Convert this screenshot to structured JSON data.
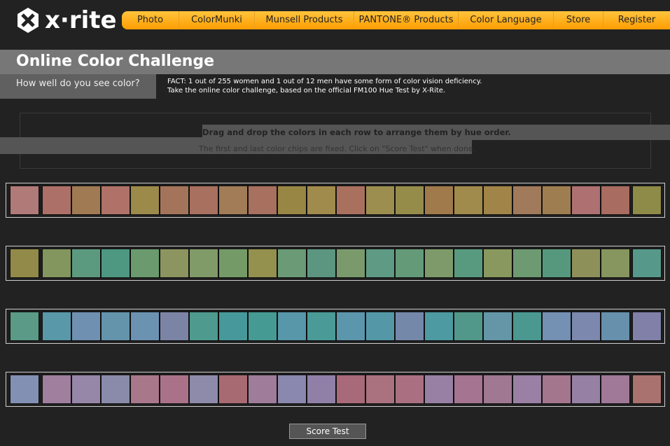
{
  "brand": {
    "logo_text": "x·rite"
  },
  "nav": [
    "Photo",
    "ColorMunki",
    "Munsell Products",
    "PANTONE® Products",
    "Color Language",
    "Store",
    "Register"
  ],
  "page": {
    "title": "Online Color Challenge",
    "subtitle": "How well do you see color?",
    "fact_line1": "FACT: 1 out of 255 women and 1 out of 12 men have some form of color vision deficiency.",
    "fact_line2": "Take the online color challenge, based on the official FM100 Hue Test by X-Rite.",
    "instruction1": "Drag and drop the colors in each row to arrange them by hue order.",
    "instruction2": "The first and last color chips are fixed. Click on \"Score Test\" when done."
  },
  "rows": [
    [
      "#b07a78",
      "#ad7068",
      "#a07a52",
      "#b07268",
      "#9c8a4a",
      "#a4745a",
      "#a8705e",
      "#a27c56",
      "#a8705e",
      "#988644",
      "#a08a4c",
      "#aa705e",
      "#9c8e4e",
      "#968c4a",
      "#a07a4a",
      "#a08a4c",
      "#a08448",
      "#a07a5a",
      "#9e7e50",
      "#ae7070",
      "#a86c60",
      "#8e8a48"
    ],
    [
      "#928a48",
      "#82965e",
      "#5c9a80",
      "#4e9882",
      "#6a9a6e",
      "#8c9460",
      "#809a68",
      "#749a68",
      "#94904e",
      "#6a9a76",
      "#5c9680",
      "#7a9a6c",
      "#5e9a84",
      "#649a78",
      "#7e9a6a",
      "#589a80",
      "#88985e",
      "#6e9a72",
      "#56987e",
      "#8e905a",
      "#86965e",
      "#56998a"
    ],
    [
      "#5a9a86",
      "#5898a8",
      "#6f90b0",
      "#6494ac",
      "#6c92b2",
      "#7c84a6",
      "#4e9a8e",
      "#46989a",
      "#469a94",
      "#5896aa",
      "#4a9a98",
      "#5c96ac",
      "#5498a8",
      "#7488aa",
      "#4e9aa2",
      "#52988a",
      "#6496a8",
      "#4a9890",
      "#7490b2",
      "#7c88ae",
      "#6690ac",
      "#8080a8"
    ],
    [
      "#8290b4",
      "#a07e9e",
      "#9686a8",
      "#8a8aaa",
      "#a8788a",
      "#aa7288",
      "#8e8aaa",
      "#a86a72",
      "#9e7c9a",
      "#8a88ae",
      "#9080a8",
      "#a86a78",
      "#aa727e",
      "#aa7082",
      "#9880a4",
      "#a47490",
      "#a07892",
      "#9a80a4",
      "#a4768e",
      "#9680a4",
      "#a07898",
      "#aa726e"
    ]
  ],
  "score_button": "Score Test",
  "colors": {
    "nav_accent": "#ffb020",
    "background": "#222222",
    "band": "#777777"
  }
}
